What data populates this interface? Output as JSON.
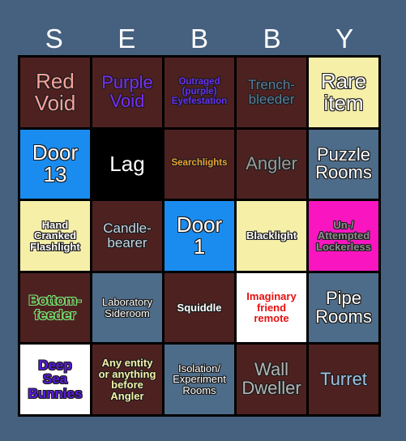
{
  "page": {
    "background_color": "#46617f",
    "title": "SEBBY Bingo Card"
  },
  "header": {
    "letters": [
      "S",
      "E",
      "B",
      "B",
      "Y"
    ],
    "color": "#ffffff"
  },
  "grid": {
    "rows": 5,
    "columns": 5,
    "border_color": "#000000",
    "cells": [
      {
        "text": "Red\nVoid",
        "bg": "#4e2121",
        "fg": "#f4a29b",
        "size": "sz-xl",
        "outline": "ol-dark",
        "bold": false
      },
      {
        "text": "Purple\nVoid",
        "bg": "#4e2121",
        "fg": "#7d2df0",
        "size": "sz-lg",
        "outline": "ol-dark",
        "bold": false
      },
      {
        "text": "Outraged\n(purple)\nEyefestation",
        "bg": "#4e2121",
        "fg": "#6a2df0",
        "size": "sz-xs",
        "outline": "ol-dark",
        "bold": true
      },
      {
        "text": "Trench-\nbleeder",
        "bg": "#4e2121",
        "fg": "#5c7d99",
        "size": "sz-md",
        "outline": "ol-dark",
        "bold": false
      },
      {
        "text": "Rare\nitem",
        "bg": "#f5efa8",
        "fg": "#ffffff",
        "size": "sz-xl",
        "outline": "ol-dark",
        "bold": false
      },
      {
        "text": "Door\n13",
        "bg": "#1a8cf0",
        "fg": "#ffffff",
        "size": "sz-xl",
        "outline": "ol-dark",
        "bold": false
      },
      {
        "text": "Lag",
        "bg": "#000000",
        "fg": "#ffffff",
        "size": "sz-xl",
        "outline": "ol-none",
        "bold": false
      },
      {
        "text": "Searchlights",
        "bg": "#4e2121",
        "fg": "#f0a030",
        "size": "sz-xs",
        "outline": "ol-dark",
        "bold": true
      },
      {
        "text": "Angler",
        "bg": "#4e2121",
        "fg": "#9a9a9a",
        "size": "sz-lg",
        "outline": "ol-dark",
        "bold": false
      },
      {
        "text": "Puzzle\nRooms",
        "bg": "#4d6c8a",
        "fg": "#ffffff",
        "size": "sz-lg",
        "outline": "ol-dark",
        "bold": false
      },
      {
        "text": "Hand\nCranked\nFlashlight",
        "bg": "#f5efa8",
        "fg": "#ffffff",
        "size": "sz-sm",
        "outline": "ol-dark",
        "bold": true
      },
      {
        "text": "Candle-\nbearer",
        "bg": "#4e2121",
        "fg": "#c6d4e2",
        "size": "sz-md",
        "outline": "ol-dark",
        "bold": false
      },
      {
        "text": "Door\n1",
        "bg": "#1a8cf0",
        "fg": "#ffffff",
        "size": "sz-xl",
        "outline": "ol-dark",
        "bold": false
      },
      {
        "text": "Blacklight",
        "bg": "#f5efa8",
        "fg": "#ffffff",
        "size": "sz-sm",
        "outline": "ol-dark",
        "bold": true
      },
      {
        "text": "Un-/\nAttempted\nLockerless",
        "bg": "#f916c0",
        "fg": "#8f8f8f",
        "size": "sz-sm",
        "outline": "ol-dark",
        "bold": true
      },
      {
        "text": "Bottom-\nfeeder",
        "bg": "#4e2121",
        "fg": "#4e2121",
        "size": "sz-md",
        "outline": "ol-green",
        "bold": true
      },
      {
        "text": "Laboratory\nSideroom",
        "bg": "#4d6c8a",
        "fg": "#ffffff",
        "size": "sz-sm",
        "outline": "ol-dark",
        "bold": false
      },
      {
        "text": "Squiddle",
        "bg": "#4e2121",
        "fg": "#ffffff",
        "size": "sz-sm",
        "outline": "ol-dark",
        "bold": true
      },
      {
        "text": "Imaginary\nfriend\nremote",
        "bg": "#ffffff",
        "fg": "#e8100f",
        "size": "sz-sm",
        "outline": "ol-white",
        "bold": true
      },
      {
        "text": "Pipe\nRooms",
        "bg": "#4d6c8a",
        "fg": "#ffffff",
        "size": "sz-lg",
        "outline": "ol-dark",
        "bold": false
      },
      {
        "text": "Deep\nSea\nBunnies",
        "bg": "#ffffff",
        "fg": "#5a1ae0",
        "size": "sz-md",
        "outline": "ol-dark",
        "bold": true
      },
      {
        "text": "Any entity\nor anything\nbefore\nAngler",
        "bg": "#4e2121",
        "fg": "#f5efa8",
        "size": "sz-sm",
        "outline": "ol-dark",
        "bold": true
      },
      {
        "text": "Isolation/\nExperiment\nRooms",
        "bg": "#4d6c8a",
        "fg": "#ffffff",
        "size": "sz-sm",
        "outline": "ol-dark",
        "bold": false
      },
      {
        "text": "Wall\nDweller",
        "bg": "#4e2121",
        "fg": "#b4b4b4",
        "size": "sz-lg",
        "outline": "ol-dark",
        "bold": false
      },
      {
        "text": "Turret",
        "bg": "#4e2121",
        "fg": "#9ec2e0",
        "size": "sz-lg",
        "outline": "ol-dark",
        "bold": false
      }
    ]
  }
}
